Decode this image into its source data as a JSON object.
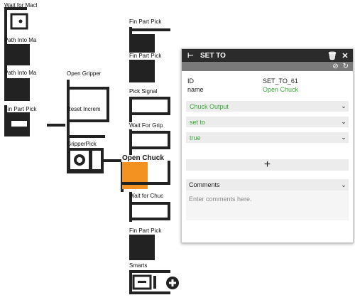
{
  "left_blocks": [
    {
      "label": "Wait for Macl"
    },
    {
      "label": "Path Into Ma"
    },
    {
      "label": "Path Into Ma"
    },
    {
      "label": "Fin Part Pick"
    }
  ],
  "middle_blocks": [
    {
      "label": "Open Gripper"
    },
    {
      "label": "Reset Increm"
    },
    {
      "label": "GripperPick"
    }
  ],
  "right_blocks": [
    {
      "label": "Fin Part Pick"
    },
    {
      "label": "Fin Part Pick"
    },
    {
      "label": "Pick Signal"
    },
    {
      "label": "Wait For Grip"
    },
    {
      "label": "Open Chuck"
    },
    {
      "label": "Wait for Chuc"
    },
    {
      "label": "Fin Part Pick"
    },
    {
      "label": "Smarts"
    }
  ],
  "colors": {
    "accent_orange": "#f39220",
    "block": "#222222",
    "green": "#3aa538",
    "header": "#2b2b2b"
  },
  "panel": {
    "title": "SET TO",
    "header_icon": "set-to-icon",
    "id_label": "ID",
    "id_value": "SET_TO_61",
    "name_label": "name",
    "name_value": "Open Chuck",
    "dropdown_1": "Chuck Output",
    "dropdown_2": "set to",
    "dropdown_3": "true",
    "add_symbol": "+",
    "comments_label": "Comments",
    "comments_placeholder": "Enter comments here."
  }
}
